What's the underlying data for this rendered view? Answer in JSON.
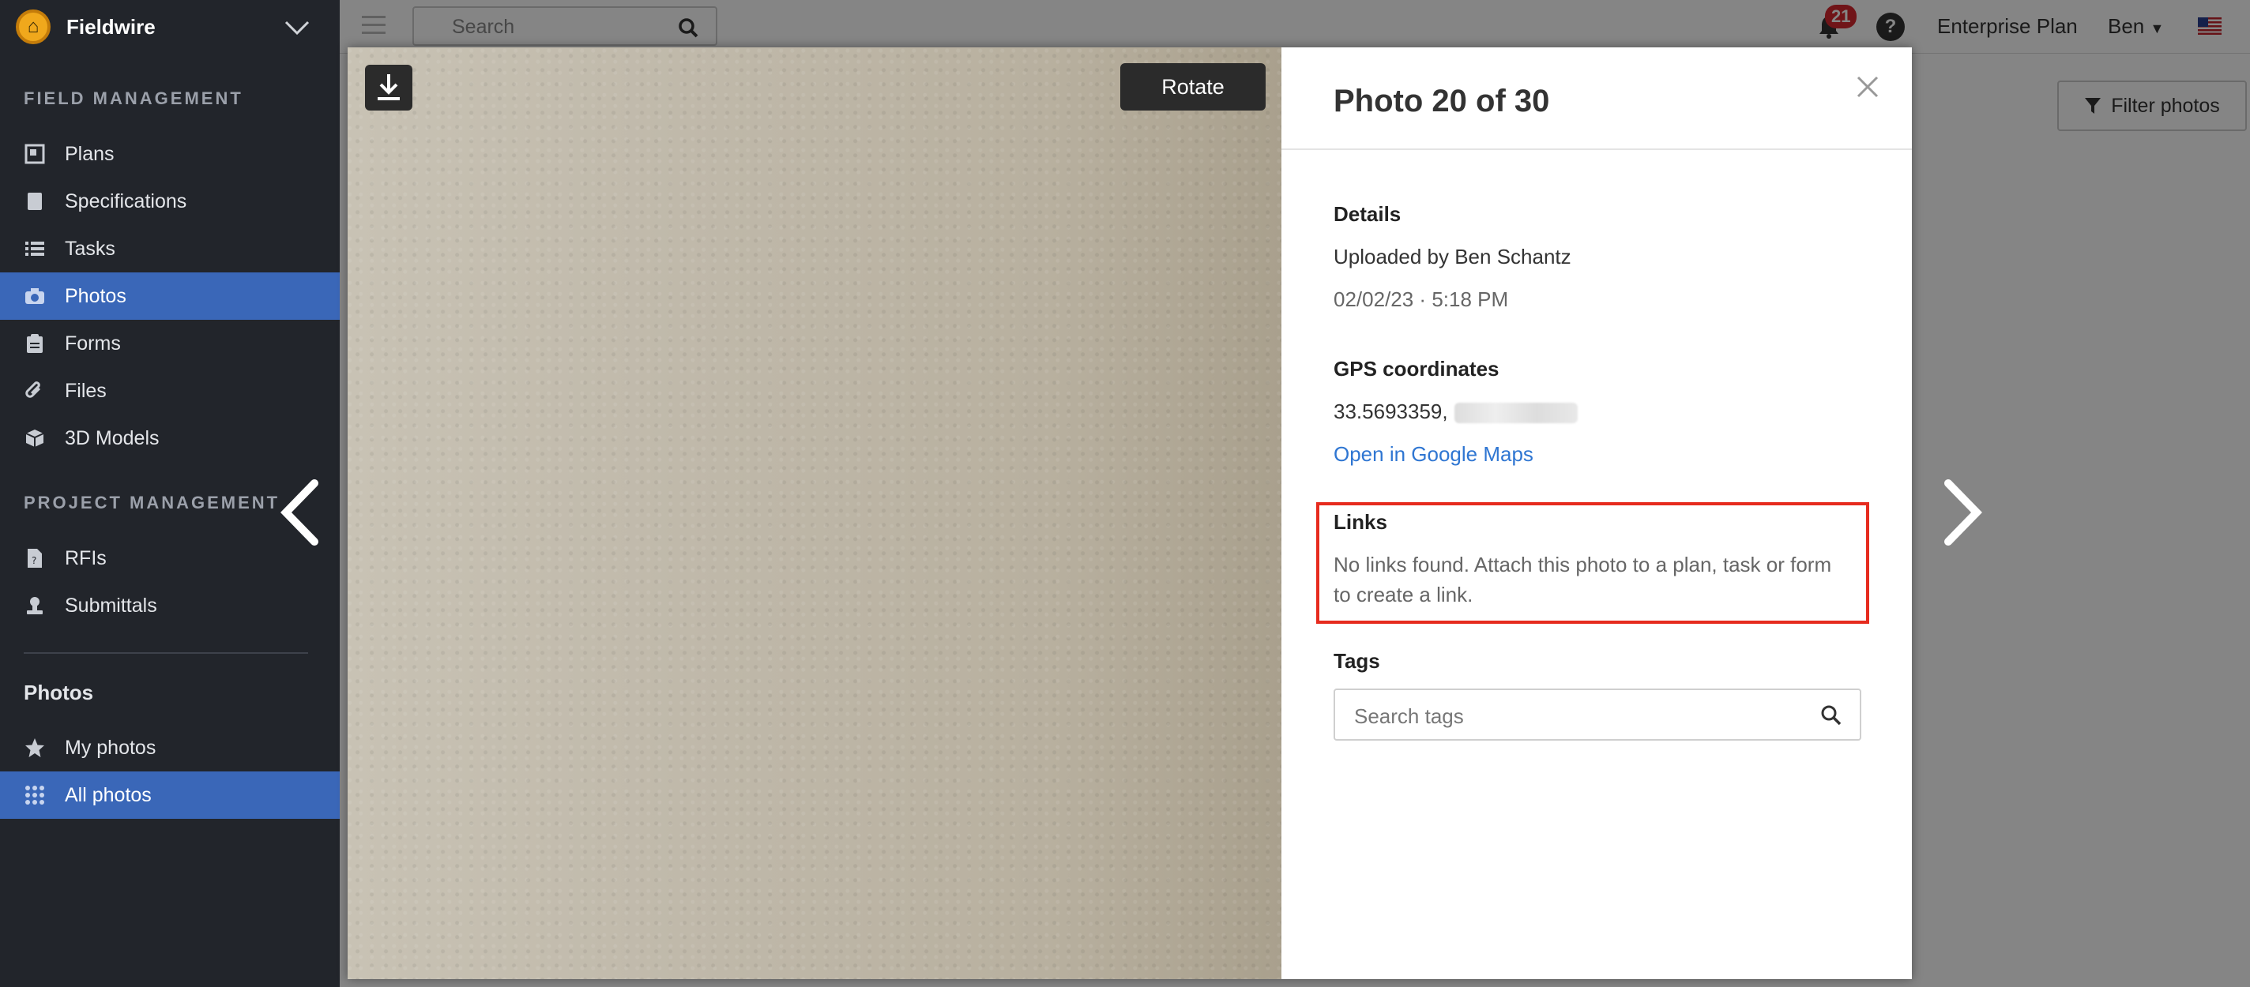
{
  "sidebar": {
    "brand": "Fieldwire",
    "field_management_heading": "FIELD MANAGEMENT",
    "field_items": [
      {
        "label": "Plans",
        "icon": "plans-icon"
      },
      {
        "label": "Specifications",
        "icon": "specifications-icon"
      },
      {
        "label": "Tasks",
        "icon": "tasks-icon"
      },
      {
        "label": "Photos",
        "icon": "camera-icon",
        "active": true
      },
      {
        "label": "Forms",
        "icon": "forms-icon"
      },
      {
        "label": "Files",
        "icon": "paperclip-icon"
      },
      {
        "label": "3D Models",
        "icon": "cube-icon"
      }
    ],
    "project_management_heading": "PROJECT MANAGEMENT",
    "project_items": [
      {
        "label": "RFIs",
        "icon": "rfi-icon"
      },
      {
        "label": "Submittals",
        "icon": "submittals-icon"
      }
    ],
    "photos_heading": "Photos",
    "photo_items": [
      {
        "label": "My photos",
        "icon": "star-icon"
      },
      {
        "label": "All photos",
        "icon": "grid-icon",
        "active": true
      }
    ]
  },
  "topbar": {
    "search_placeholder": "Search",
    "notification_count": "21",
    "help": "?",
    "plan": "Enterprise Plan",
    "user": "Ben",
    "filter_label": "Filter photos"
  },
  "viewer": {
    "rotate_label": "Rotate"
  },
  "details": {
    "title": "Photo 20 of 30",
    "details_label": "Details",
    "uploaded_by": "Uploaded by Ben Schantz",
    "timestamp": "02/02/23 · 5:18 PM",
    "gps_label": "GPS coordinates",
    "gps_value": "33.5693359,",
    "maps_link": "Open in Google Maps",
    "links_label": "Links",
    "links_text": "No links found. Attach this photo to a plan, task or form to create a link.",
    "tags_label": "Tags",
    "tags_placeholder": "Search tags"
  },
  "colors": {
    "sidebar_bg": "#22252b",
    "active_bg": "#3a67b8",
    "highlight": "#e62b1e",
    "link": "#2f76d2"
  }
}
